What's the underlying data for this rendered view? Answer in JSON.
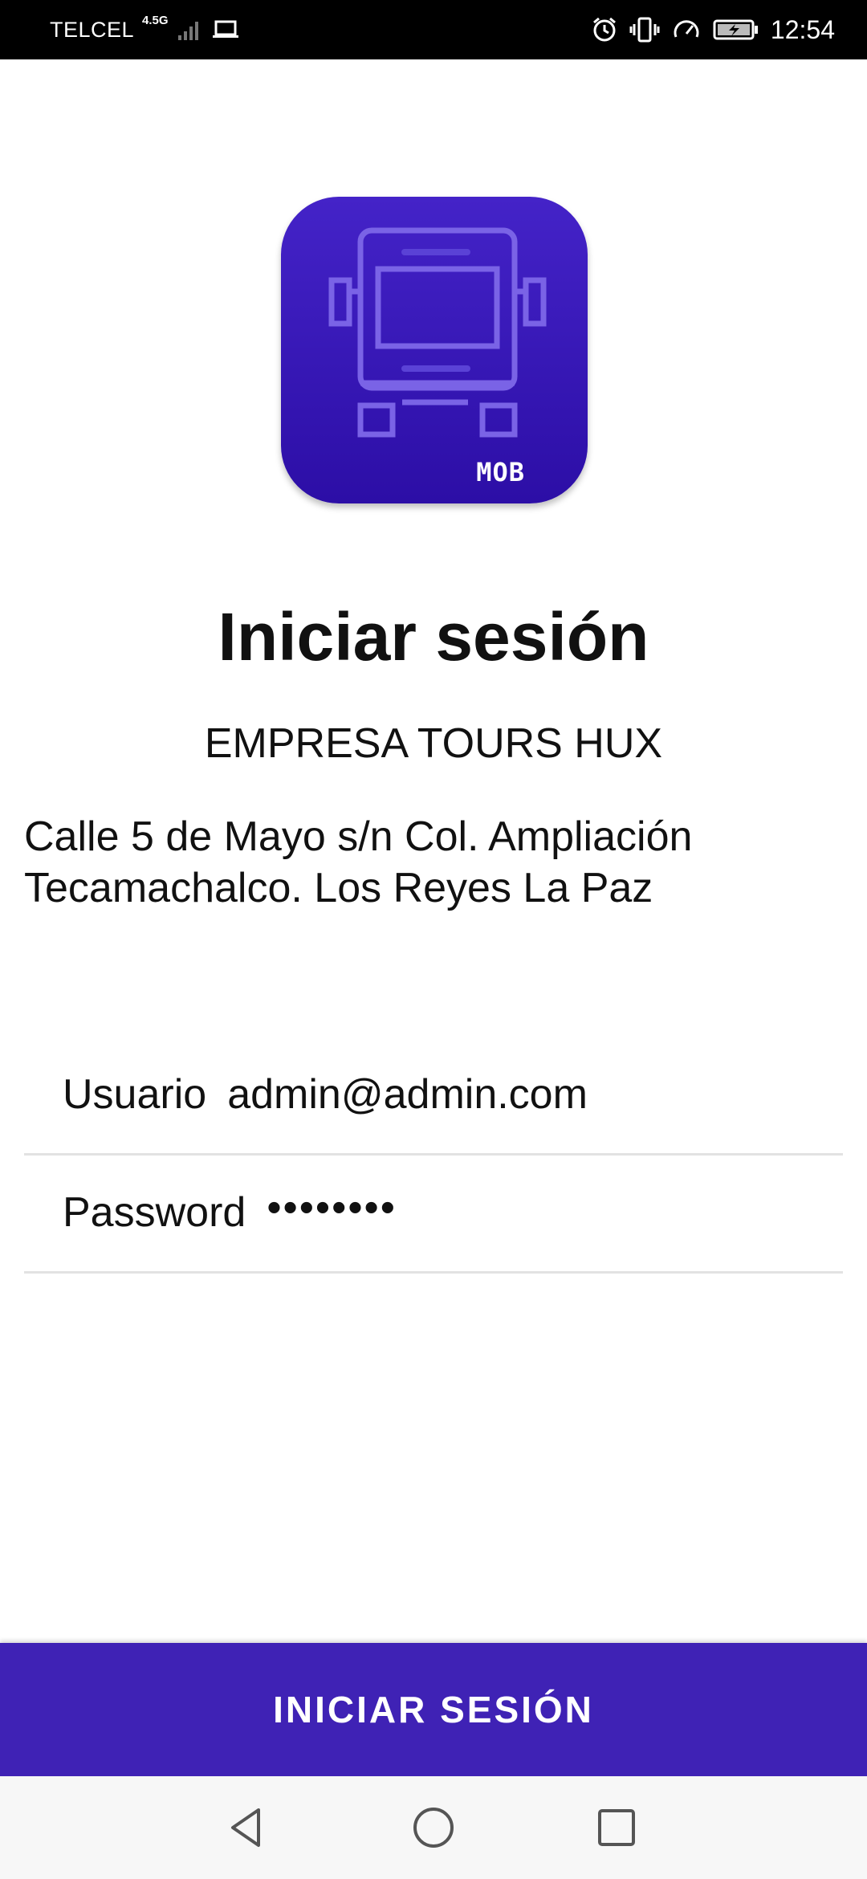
{
  "status_bar": {
    "carrier": "TELCEL",
    "network_type": "4.5G",
    "time": "12:54",
    "icons": [
      "signal-icon",
      "laptop-icon",
      "alarm-icon",
      "vibrate-icon",
      "speed-icon",
      "battery-charging-icon"
    ]
  },
  "app_logo": {
    "label": "MOB",
    "icon": "bus-icon",
    "color": "#3a1bbd"
  },
  "login": {
    "title": "Iniciar sesión",
    "company_name": "EMPRESA TOURS HUX",
    "company_address": "Calle 5 de Mayo s/n Col. Ampliación Tecamachalco. Los Reyes La Paz",
    "username_label": "Usuario",
    "username_value": "admin@admin.com",
    "password_label": "Password",
    "password_value": "••••••••",
    "button_label": "INICIAR SESIÓN",
    "button_color": "#3f22b5"
  },
  "nav_bar": {
    "icons": [
      "back-icon",
      "home-icon",
      "recent-apps-icon"
    ]
  }
}
